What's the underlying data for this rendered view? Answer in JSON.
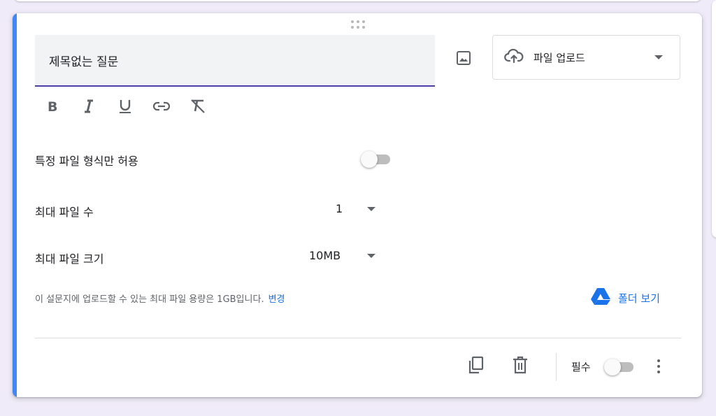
{
  "question": {
    "title": "제목없는 질문",
    "type_label": "파일 업로드"
  },
  "format_toolbar": {
    "items": [
      "bold-icon",
      "italic-icon",
      "underline-icon",
      "link-icon",
      "clear-format-icon"
    ]
  },
  "settings": {
    "allow_specific_types_label": "특정 파일 형식만 허용",
    "allow_specific_types_on": false,
    "max_files_label": "최대 파일 수",
    "max_files_value": "1",
    "max_size_label": "최대 파일 크기",
    "max_size_value": "10MB"
  },
  "storage_info": {
    "text": "이 설문지에 업로드할 수 있는 최대 파일 용량은 1GB입니다.",
    "change_label": "변경"
  },
  "folder_link": {
    "label": "폴더 보기",
    "icon": "google-drive-icon"
  },
  "footer": {
    "required_label": "필수",
    "required_on": false
  },
  "colors": {
    "accent": "#4285f4",
    "title_underline": "#4b3fa8",
    "link": "#1a73e8",
    "background": "#f0ebf8"
  }
}
